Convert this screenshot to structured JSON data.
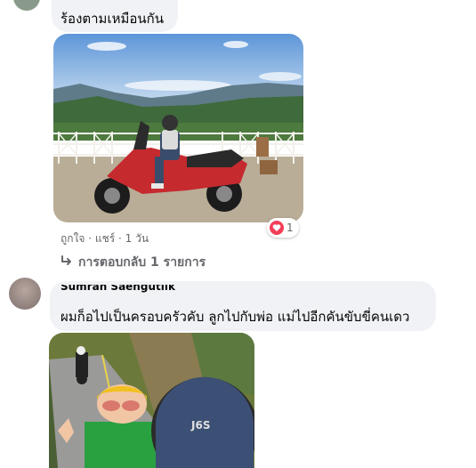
{
  "comment1": {
    "text": "ร้องตามเหมือนกัน",
    "actions": {
      "like": "ถูกใจ",
      "sep1": " · ",
      "share": "แชร์",
      "sep2": " · ",
      "time": "1 วัน"
    },
    "reaction_count": "1",
    "reaction_icon": "heart-icon",
    "reply_label": "การตอบกลับ 1 รายการ",
    "reply_icon": "reply-arrow-icon"
  },
  "comment2": {
    "author": "Sumran Saengutiik",
    "text": "ผมก็อไปเป็นครอบครัวคับ ลูกไปกับพ่อ แม่ไปอีกคันขับขี่คนเดว"
  },
  "colors": {
    "bubble": "#f0f2f5",
    "meta_text": "#65676b",
    "heart": "#f33e58"
  }
}
